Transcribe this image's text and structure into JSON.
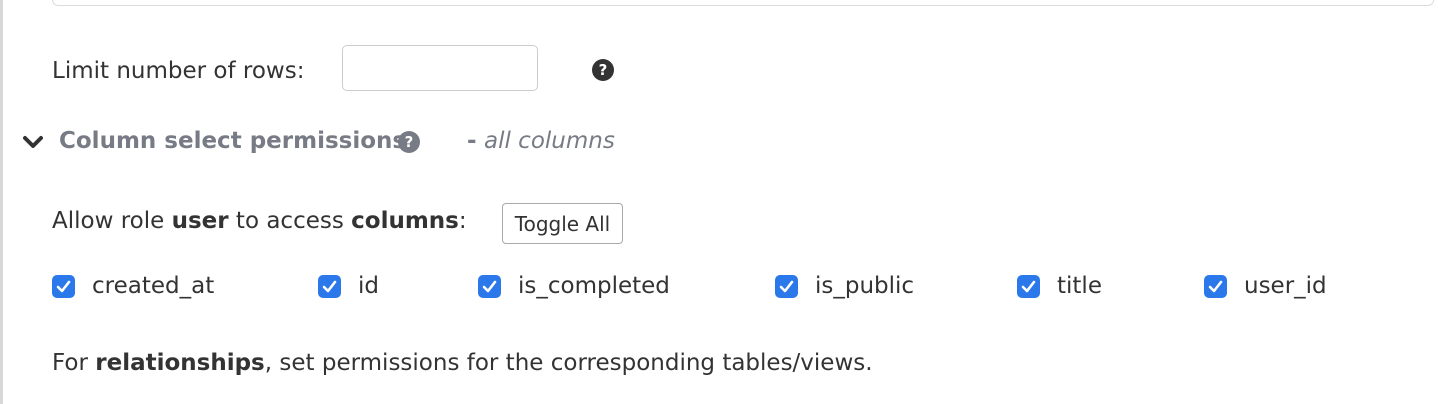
{
  "limit": {
    "label": "Limit number of rows:",
    "value": "",
    "help_icon": "question-circle-icon"
  },
  "section": {
    "toggle_icon": "chevron-down-icon",
    "title": "Column select permissions",
    "help_icon": "question-circle-icon",
    "dash": "-",
    "note": "all columns"
  },
  "access": {
    "prefix": "Allow role",
    "role": "user",
    "middle": "to access",
    "target": "columns",
    "suffix": ":",
    "toggle_all_label": "Toggle All"
  },
  "columns": [
    {
      "name": "created_at",
      "checked": true
    },
    {
      "name": "id",
      "checked": true
    },
    {
      "name": "is_completed",
      "checked": true
    },
    {
      "name": "is_public",
      "checked": true
    },
    {
      "name": "title",
      "checked": true
    },
    {
      "name": "user_id",
      "checked": true
    }
  ],
  "footer": {
    "prefix": "For",
    "bold": "relationships",
    "rest": ", set permissions for the corresponding tables/views."
  },
  "colors": {
    "checkbox": "#2b78ea",
    "section_title": "#777b85",
    "text": "#333333"
  }
}
